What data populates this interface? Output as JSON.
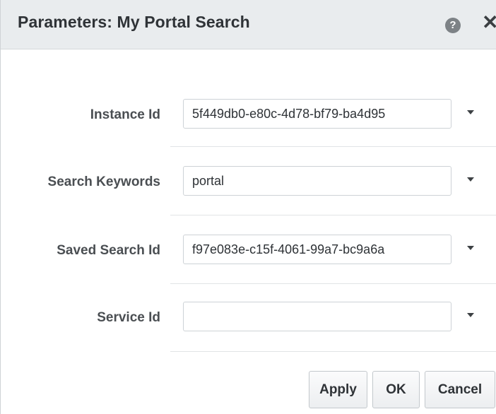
{
  "dialog": {
    "title": "Parameters: My Portal Search",
    "help_icon": "?",
    "close_icon": "✕"
  },
  "parameters": [
    {
      "label": "Instance Id",
      "value": "5f449db0-e80c-4d78-bf79-ba4d95",
      "icon": "chevron-down-icon"
    },
    {
      "label": "Search Keywords",
      "value": "portal",
      "icon": "chevron-down-icon"
    },
    {
      "label": "Saved Search Id",
      "value": "f97e083e-c15f-4061-99a7-bc9a6a",
      "icon": "chevron-down-icon"
    },
    {
      "label": "Service Id",
      "value": "",
      "icon": "chevron-down-icon"
    }
  ],
  "buttons": {
    "apply": "Apply",
    "ok": "OK",
    "cancel": "Cancel"
  }
}
